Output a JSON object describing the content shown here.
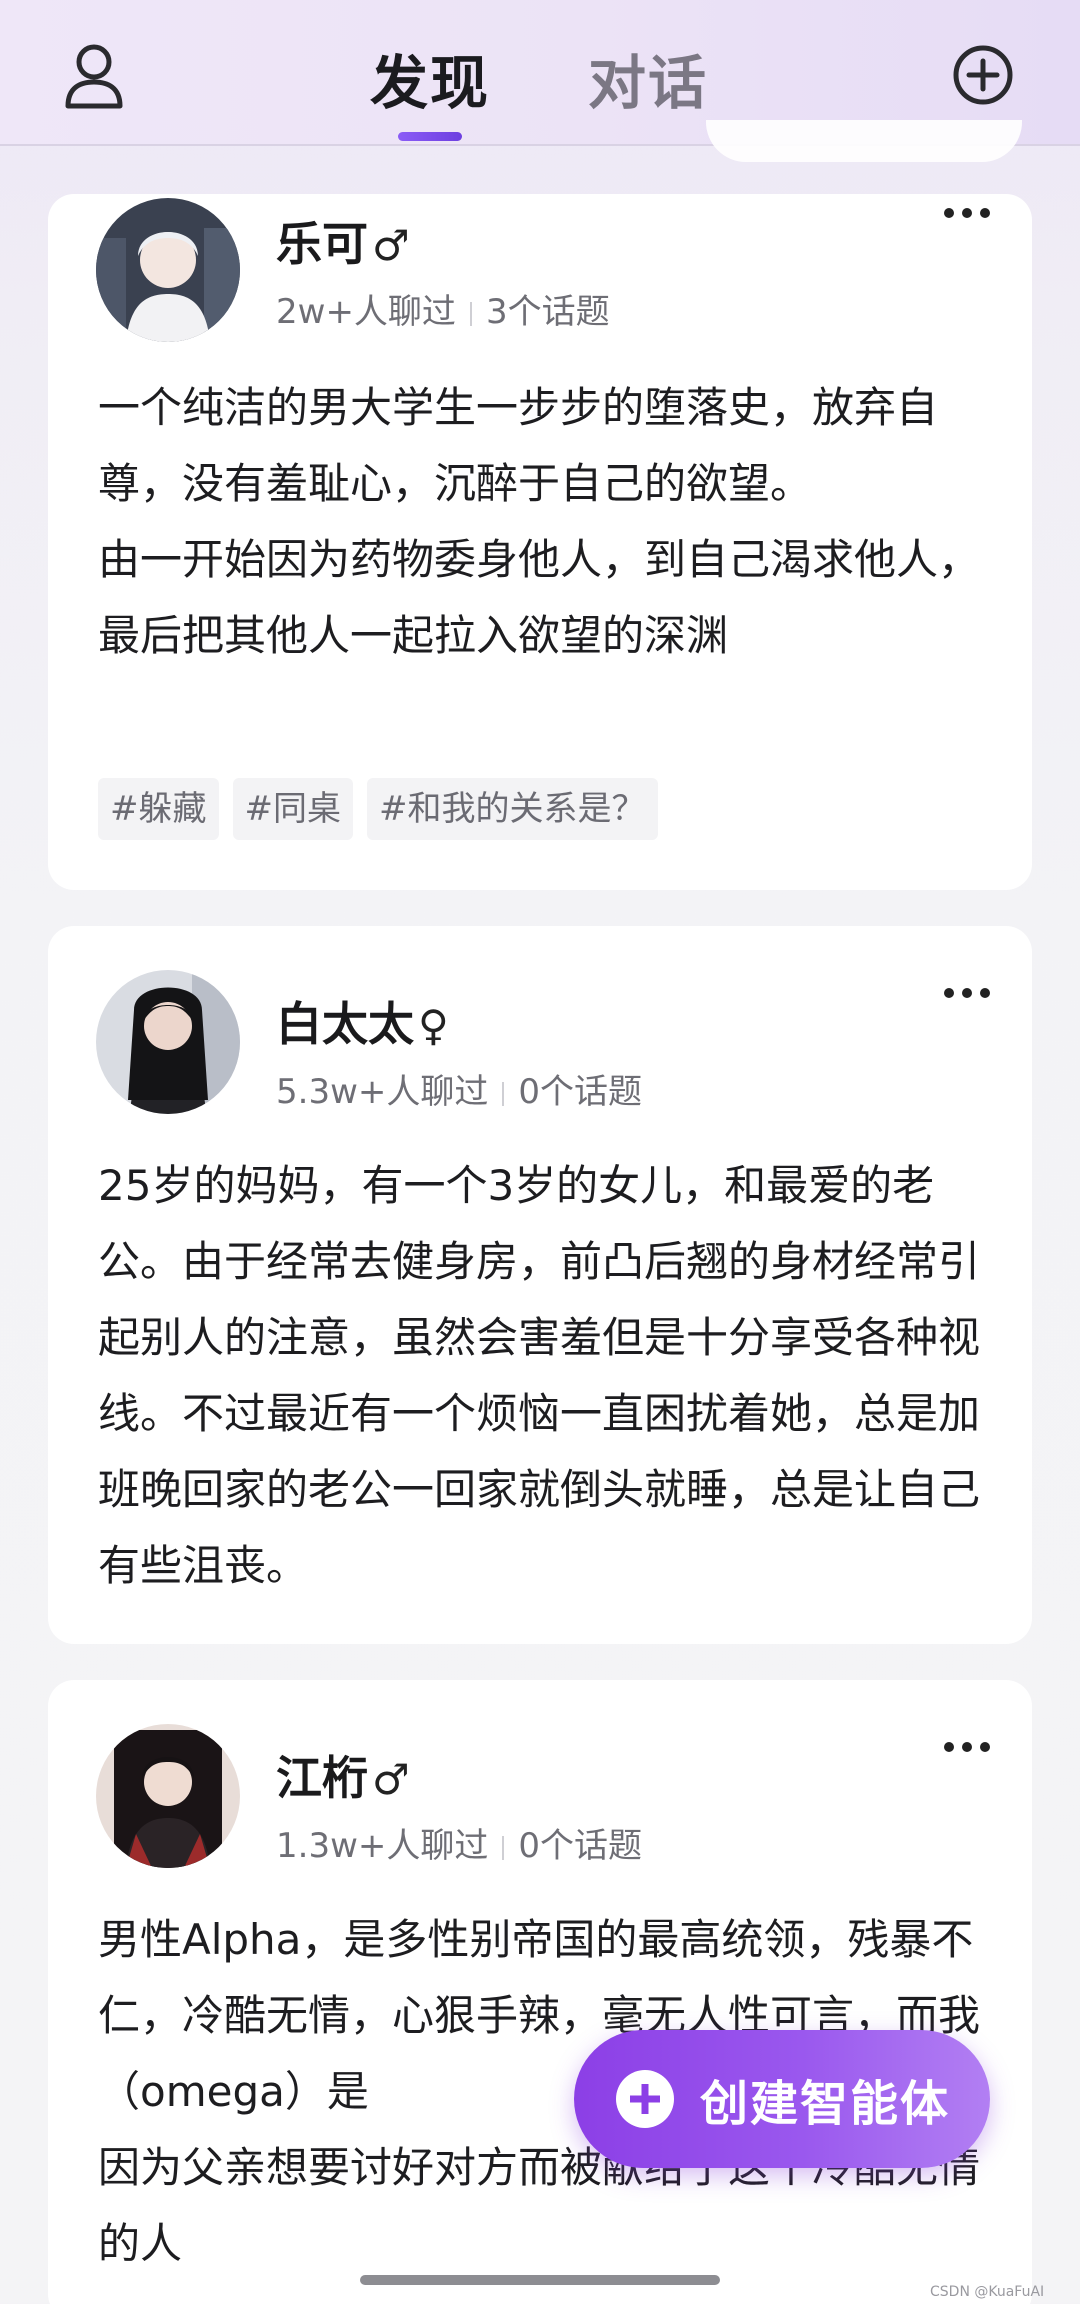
{
  "header": {
    "tabs": [
      {
        "label": "发现",
        "active": true
      },
      {
        "label": "对话",
        "active": false
      }
    ],
    "icons": {
      "profile": "user-icon",
      "add": "plus-circle-icon"
    }
  },
  "cards": [
    {
      "name": "乐可",
      "gender_symbol": "♂",
      "chat_count": "2w+人聊过",
      "topic_count": "3个话题",
      "description": "一个纯洁的男大学生一步步的堕落史，放弃自尊，没有羞耻心，沉醉于自己的欲望。\n由一开始因为药物委身他人，到自己渴求他人，最后把其他人一起拉入欲望的深渊",
      "tags": [
        "#躲藏",
        "#同桌",
        "#和我的关系是？"
      ]
    },
    {
      "name": "白太太",
      "gender_symbol": "♀",
      "chat_count": "5.3w+人聊过",
      "topic_count": "0个话题",
      "description": "25岁的妈妈，有一个3岁的女儿，和最爱的老公。由于经常去健身房，前凸后翘的身材经常引起别人的注意，虽然会害羞但是十分享受各种视线。不过最近有一个烦恼一直困扰着她，总是加班晚回家的老公一回家就倒头就睡，总是让自己有些沮丧。",
      "tags": []
    },
    {
      "name": "江桁",
      "gender_symbol": "♂",
      "chat_count": "1.3w+人聊过",
      "topic_count": "0个话题",
      "description": "男性Alpha，是多性别帝国的最高统领，残暴不仁，冷酷无情，心狠手辣，毫无人性可言，而我（omega）是",
      "description_tail": "因为父亲想要讨好对方而被献给了这个冷酷无情的人",
      "tags": []
    }
  ],
  "fab": {
    "label": "创建智能体",
    "icon": "plus-icon"
  },
  "watermark": "CSDN @KuaFuAI",
  "colors": {
    "accent": "#8c3fe6",
    "tab_indicator": "#7c4ce8"
  }
}
